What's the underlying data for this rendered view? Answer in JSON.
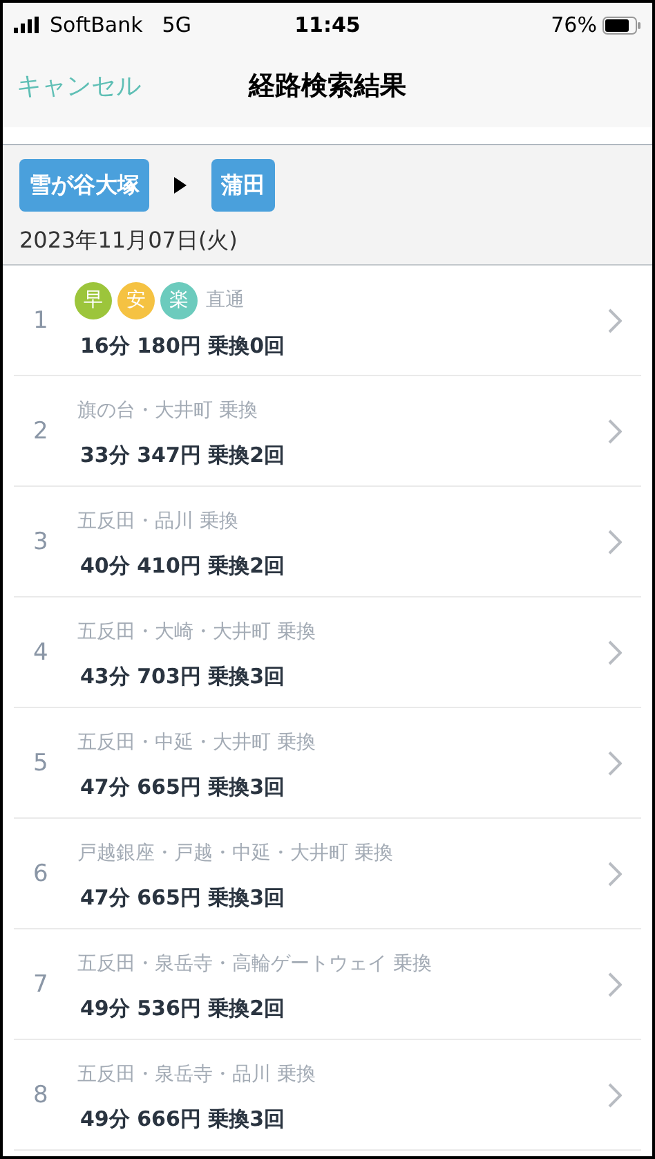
{
  "status_bar": {
    "carrier": "SoftBank",
    "network": "5G",
    "time": "11:45",
    "battery": "76%"
  },
  "nav": {
    "cancel": "キャンセル",
    "title": "経路検索結果"
  },
  "route": {
    "from": "雪が谷大塚",
    "to": "蒲田",
    "date": "2023年11月07日(火)"
  },
  "results": [
    {
      "number": "1",
      "badges": [
        {
          "label": "早",
          "color": "#9cc53b"
        },
        {
          "label": "安",
          "color": "#f5c242"
        },
        {
          "label": "楽",
          "color": "#6ccbbd"
        }
      ],
      "via": "直通",
      "summary": "16分 180円 乗換0回"
    },
    {
      "number": "2",
      "via": "旗の台・大井町 乗換",
      "summary": "33分 347円 乗換2回"
    },
    {
      "number": "3",
      "via": "五反田・品川 乗換",
      "summary": "40分 410円 乗換2回"
    },
    {
      "number": "4",
      "via": "五反田・大崎・大井町 乗換",
      "summary": "43分 703円 乗換3回"
    },
    {
      "number": "5",
      "via": "五反田・中延・大井町 乗換",
      "summary": "47分 665円 乗換3回"
    },
    {
      "number": "6",
      "via": "戸越銀座・戸越・中延・大井町 乗換",
      "summary": "47分 665円 乗換3回"
    },
    {
      "number": "7",
      "via": "五反田・泉岳寺・高輪ゲートウェイ 乗換",
      "summary": "49分 536円 乗換2回"
    },
    {
      "number": "8",
      "via": "五反田・泉岳寺・品川 乗換",
      "summary": "49分 666円 乗換3回"
    }
  ]
}
